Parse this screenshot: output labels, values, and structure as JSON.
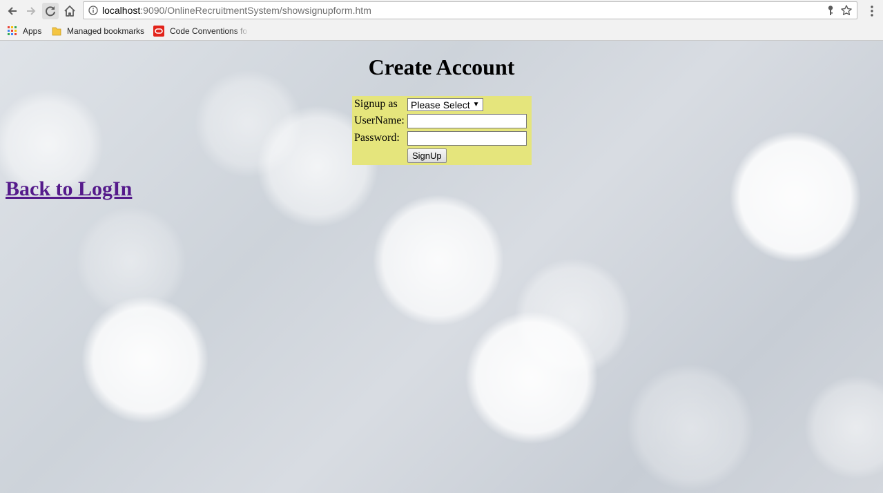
{
  "browser": {
    "url_host": "localhost",
    "url_rest": ":9090/OnlineRecruitmentSystem/showsignupform.htm",
    "icons": [
      "back-arrow-icon",
      "forward-arrow-icon",
      "reload-icon",
      "home-icon",
      "info-icon",
      "key-icon",
      "star-icon",
      "menu-dots-icon"
    ],
    "bookmarks": [
      {
        "label": "Apps",
        "icon": "apps-grid-icon"
      },
      {
        "label": "Managed bookmarks",
        "icon": "folder-icon"
      },
      {
        "label": "Code Conventions fo",
        "icon": "oracle-icon"
      }
    ]
  },
  "page": {
    "title": "Create Account",
    "form": {
      "signup_as_label": "Signup as",
      "signup_as_value": "Please Select",
      "username_label": "UserName:",
      "password_label": "Password:",
      "submit_label": "SignUp"
    },
    "back_link": "Back to LogIn"
  },
  "colors": {
    "form_background": "#e5e57c",
    "visited_link": "#551a8b"
  }
}
